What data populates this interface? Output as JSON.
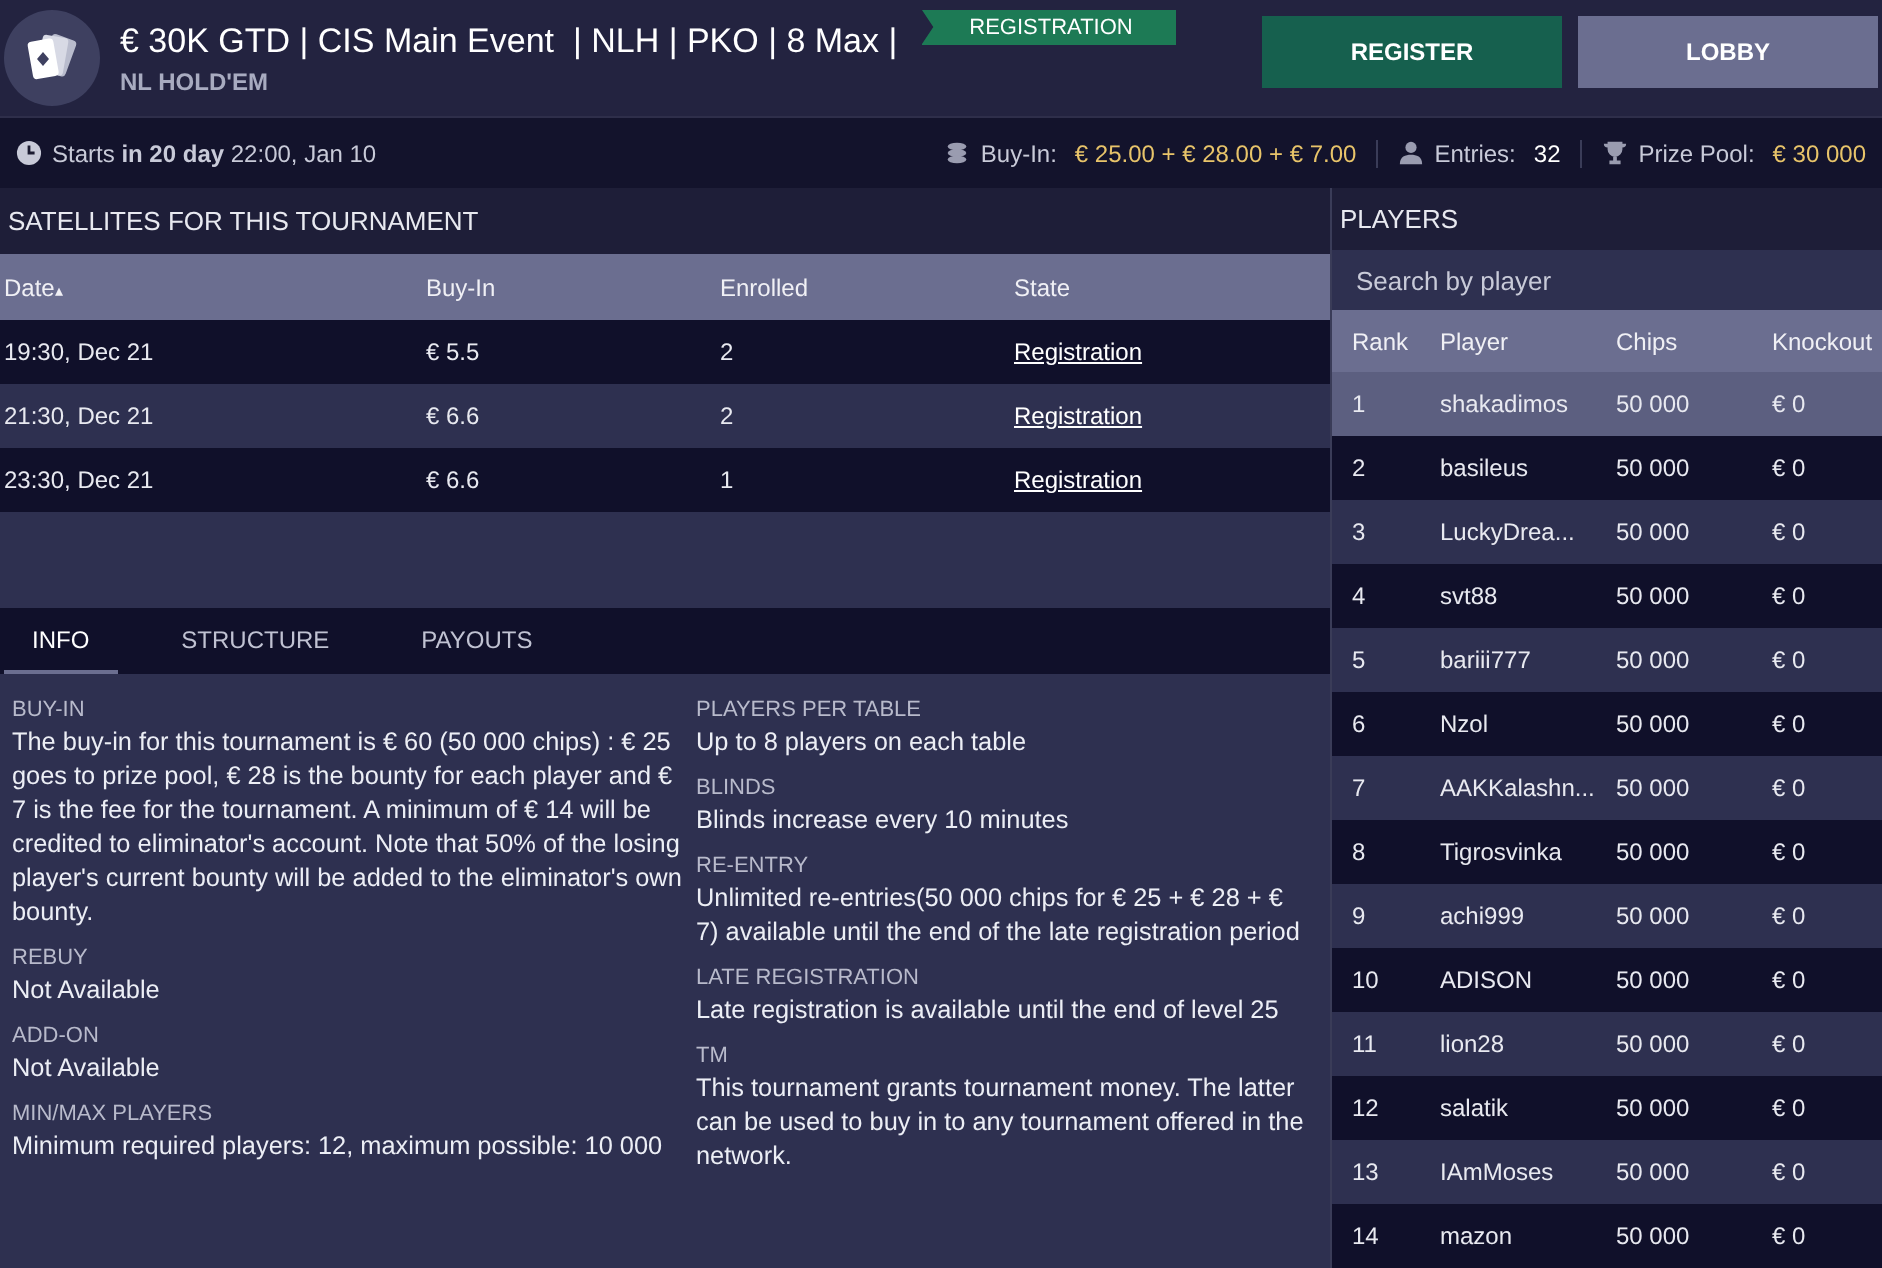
{
  "header": {
    "title": "€ 30K GTD | CIS Main Event  | NLH | PKO | 8 Max |",
    "subtitle": "NL HOLD'EM",
    "badge": "REGISTRATION",
    "buttons": [
      {
        "label": "REGISTER",
        "kind": "primary"
      },
      {
        "label": "LOBBY",
        "kind": "secondary"
      }
    ]
  },
  "info_bar": {
    "starts": "Starts **in 20 day** 22:00, Jan 10",
    "buy_in_label": "Buy-In:",
    "buy_in_value": "€ 25.00 + € 28.00 + € 7.00",
    "entries_label": "Entries:",
    "entries_value": "32",
    "prize_label": "Prize Pool:",
    "prize_value": "€ 30 000"
  },
  "satellites": {
    "title": "SATELLITES FOR THIS TOURNAMENT",
    "columns": [
      {
        "label": "Date",
        "sort": "▴"
      },
      {
        "label": "Buy-In"
      },
      {
        "label": "Enrolled"
      },
      {
        "label": "State"
      }
    ],
    "rows": [
      {
        "date": "19:30, Dec 21",
        "buy_in": "€ 5.5",
        "enrolled": "2",
        "state": "Registration"
      },
      {
        "date": "21:30, Dec 21",
        "buy_in": "€ 6.6",
        "enrolled": "2",
        "state": "Registration"
      },
      {
        "date": "23:30, Dec 21",
        "buy_in": "€ 6.6",
        "enrolled": "1",
        "state": "Registration"
      }
    ]
  },
  "tabs": [
    {
      "label": "INFO",
      "selected": true
    },
    {
      "label": "STRUCTURE",
      "selected": false
    },
    {
      "label": "PAYOUTS",
      "selected": false
    }
  ],
  "info": {
    "left": [
      {
        "title": "BUY-IN",
        "text": "The buy-in for this tournament is € 60 (50 000 chips) : € 25 goes to prize pool, € 28 is the bounty for each player and € 7 is the fee for the tournament. A minimum of € 14 will be credited to eliminator's account. Note that 50% of the losing player's current bounty will be added to the eliminator's own bounty."
      },
      {
        "title": "REBUY",
        "text": "Not Available"
      },
      {
        "title": "ADD-ON",
        "text": "Not Available"
      },
      {
        "title": "MIN/MAX PLAYERS",
        "text": "Minimum required players: 12, maximum possible: 10 000"
      }
    ],
    "right": [
      {
        "title": "PLAYERS PER TABLE",
        "text": "Up to 8 players on each table"
      },
      {
        "title": "BLINDS",
        "text": "Blinds increase every 10 minutes"
      },
      {
        "title": "RE-ENTRY",
        "text": "Unlimited re-entries(50 000 chips for € 25 + € 28 + € 7) available until the end of the late registration period"
      },
      {
        "title": "LATE REGISTRATION",
        "text": "Late registration is available until the end of level 25"
      },
      {
        "title": "TM",
        "text": "This tournament grants tournament money. The latter can be used to buy in to any tournament offered in the network."
      }
    ]
  },
  "players": {
    "title": "PLAYERS",
    "search": {
      "placeholder": "Search by player"
    },
    "columns": [
      "Rank",
      "Player",
      "Chips",
      "Knockout"
    ],
    "rows": [
      {
        "rank": "1",
        "player": "shakadimos",
        "chips": "50 000",
        "knockout": "€ 0",
        "selected": true
      },
      {
        "rank": "2",
        "player": "basileus",
        "chips": "50 000",
        "knockout": "€ 0",
        "selected": false
      },
      {
        "rank": "3",
        "player": "LuckyDrea...",
        "chips": "50 000",
        "knockout": "€ 0",
        "selected": false
      },
      {
        "rank": "4",
        "player": "svt88",
        "chips": "50 000",
        "knockout": "€ 0",
        "selected": false
      },
      {
        "rank": "5",
        "player": "bariii777",
        "chips": "50 000",
        "knockout": "€ 0",
        "selected": false
      },
      {
        "rank": "6",
        "player": "Nzol",
        "chips": "50 000",
        "knockout": "€ 0",
        "selected": false
      },
      {
        "rank": "7",
        "player": "AAKKalashn...",
        "chips": "50 000",
        "knockout": "€ 0",
        "selected": false
      },
      {
        "rank": "8",
        "player": "Tigrosvinka",
        "chips": "50 000",
        "knockout": "€ 0",
        "selected": false
      },
      {
        "rank": "9",
        "player": "achi999",
        "chips": "50 000",
        "knockout": "€ 0",
        "selected": false
      },
      {
        "rank": "10",
        "player": "ADISON",
        "chips": "50 000",
        "knockout": "€ 0",
        "selected": false
      },
      {
        "rank": "11",
        "player": "lion28",
        "chips": "50 000",
        "knockout": "€ 0",
        "selected": false
      },
      {
        "rank": "12",
        "player": "salatik",
        "chips": "50 000",
        "knockout": "€ 0",
        "selected": false
      },
      {
        "rank": "13",
        "player": "IAmMoses",
        "chips": "50 000",
        "knockout": "€ 0",
        "selected": false
      },
      {
        "rank": "14",
        "player": "mazon",
        "chips": "50 000",
        "knockout": "€ 0",
        "selected": false
      }
    ]
  }
}
